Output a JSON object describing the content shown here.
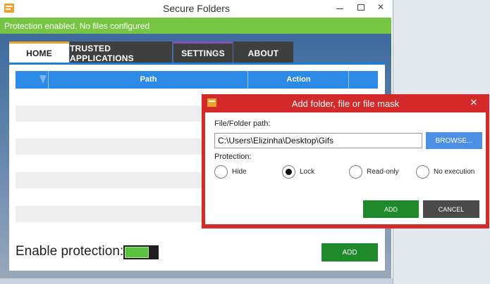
{
  "window": {
    "title": "Secure Folders"
  },
  "status": {
    "text": "Protection enabled. No files configured",
    "color": "#76c543"
  },
  "tabs": [
    {
      "label": "HOME",
      "active": true
    },
    {
      "label": "TRUSTED APPLICATIONS",
      "active": false
    },
    {
      "label": "SETTINGS",
      "active": false
    },
    {
      "label": "ABOUT",
      "active": false
    }
  ],
  "table": {
    "columns": [
      "",
      "Path",
      "Action",
      ""
    ],
    "filter_icon": "filter-icon",
    "rows": []
  },
  "footer": {
    "enable_label": "Enable protection:",
    "toggle_on": true,
    "add_label": "ADD"
  },
  "dialog": {
    "title": "Add folder, file or file mask",
    "path_label": "File/Folder path:",
    "path_value": "C:\\Users\\Elizinha\\Desktop\\Gifs",
    "browse_label": "BROWSE...",
    "protection_label": "Protection:",
    "options": [
      {
        "label": "Hide",
        "checked": false
      },
      {
        "label": "Lock",
        "checked": true
      },
      {
        "label": "Read-only",
        "checked": false
      },
      {
        "label": "No execution",
        "checked": false
      }
    ],
    "add_label": "ADD",
    "cancel_label": "CANCEL",
    "border_color": "#d42a2a"
  },
  "colors": {
    "accent_blue": "#2d8ae6",
    "add_green": "#1f8a2c",
    "tab_dark": "#3f3f3f"
  }
}
